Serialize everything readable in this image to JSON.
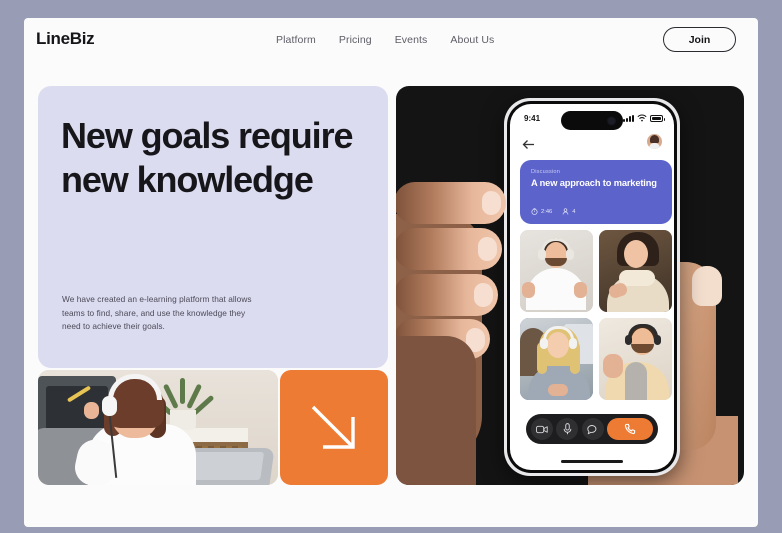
{
  "brand": {
    "logo": "LineBiz",
    "accent_orange": "#ee7b34",
    "accent_purple": "#5c63cb",
    "lavender": "#dcdcf0",
    "page_bg": "#989cb4"
  },
  "header": {
    "nav": [
      {
        "label": "Platform"
      },
      {
        "label": "Pricing"
      },
      {
        "label": "Events"
      },
      {
        "label": "About Us"
      }
    ],
    "cta": {
      "label": "Join"
    }
  },
  "hero": {
    "title": "New goals require new knowledge",
    "paragraph": "We have created an e-learning platform that allows teams to find, share, and use the knowledge they need to achieve their goals."
  },
  "cards": {
    "photo": {
      "alt": "woman-with-headphones-at-laptop"
    },
    "arrow": {
      "icon": "arrow-down-right-icon"
    }
  },
  "phone": {
    "status": {
      "time": "9:41",
      "signal": "signal-bars-icon",
      "wifi": "wifi-icon",
      "battery": "battery-icon"
    },
    "app_bar": {
      "back": "back-arrow-icon",
      "avatar": "user-avatar"
    },
    "discussion": {
      "eyebrow": "Discussion",
      "title": "A new approach to marketing",
      "timer": "2:46",
      "participants": "4",
      "timer_icon": "stopwatch-icon",
      "participants_icon": "person-icon"
    },
    "participants": [
      {
        "name": "participant-1",
        "active": false
      },
      {
        "name": "participant-2",
        "active": false
      },
      {
        "name": "participant-3",
        "active": true
      },
      {
        "name": "participant-4",
        "active": false
      }
    ],
    "controls": [
      {
        "icon": "video-camera-icon",
        "name": "video-toggle"
      },
      {
        "icon": "microphone-icon",
        "name": "mic-toggle"
      },
      {
        "icon": "chat-bubble-icon",
        "name": "chat-button"
      },
      {
        "icon": "phone-end-call-icon",
        "name": "end-call-button"
      }
    ]
  }
}
